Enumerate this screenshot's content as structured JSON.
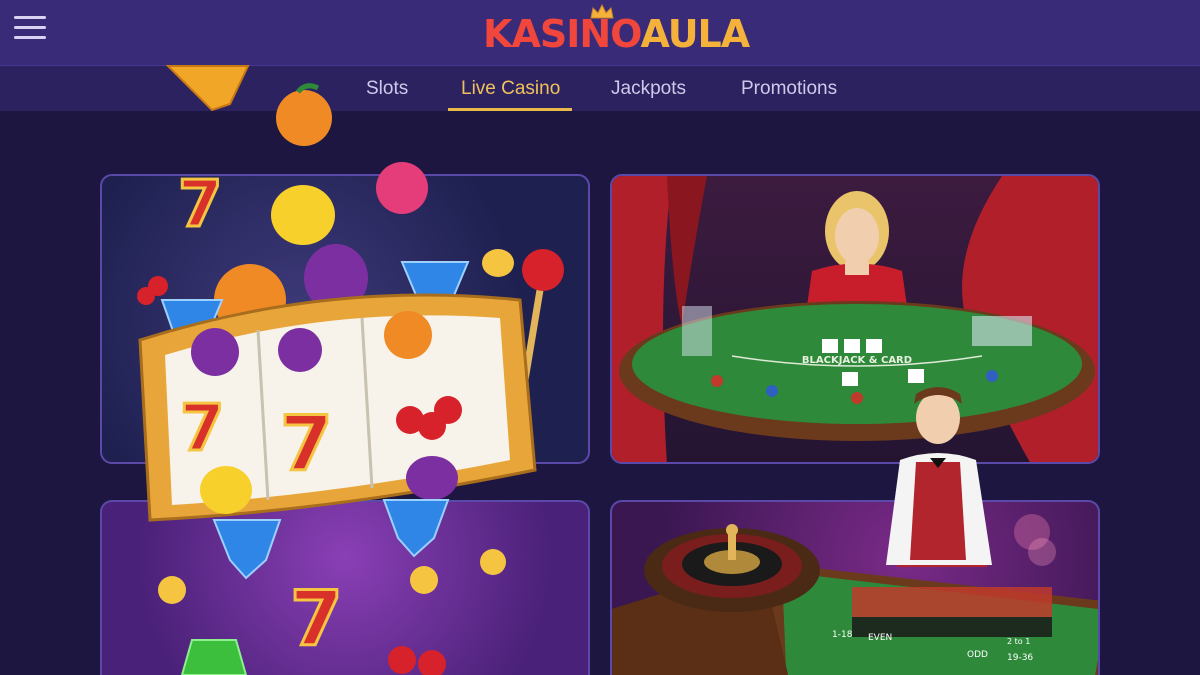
{
  "header": {
    "logo_part1": "KASINO",
    "logo_part2": "AULA"
  },
  "nav": {
    "tabs": [
      {
        "label": "Slots"
      },
      {
        "label": "Live Casino"
      },
      {
        "label": "Jackpots"
      },
      {
        "label": "Promotions"
      }
    ],
    "active_index": 1
  },
  "cards": {
    "blackjack_table_text": "BLACKJACK & CARD",
    "roulette_labels": [
      "1-18",
      "EVEN",
      "ODD",
      "19-36",
      "2 to 1"
    ]
  },
  "colors": {
    "topbar": "#3a2b78",
    "navbar": "#2c2260",
    "accent": "#f1c15c",
    "logo_red": "#f0463c",
    "logo_gold": "#f5b23a"
  }
}
